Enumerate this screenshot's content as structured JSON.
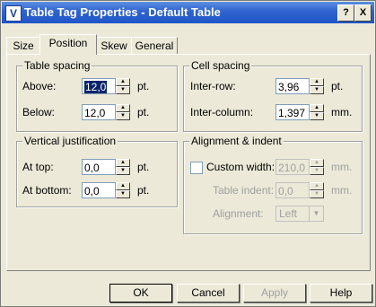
{
  "window": {
    "title": "Table Tag Properties - Default Table",
    "app_icon_letter": "V",
    "help_glyph": "?",
    "close_glyph": "X"
  },
  "tabs": [
    {
      "label": "Size",
      "active": false
    },
    {
      "label": "Position",
      "active": true
    },
    {
      "label": "Skew",
      "active": false
    },
    {
      "label": "General",
      "active": false
    }
  ],
  "table_spacing": {
    "title": "Table spacing",
    "above": {
      "label": "Above:",
      "value": "12,0",
      "unit": "pt."
    },
    "below": {
      "label": "Below:",
      "value": "12,0",
      "unit": "pt."
    }
  },
  "cell_spacing": {
    "title": "Cell spacing",
    "inter_row": {
      "label": "Inter-row:",
      "value": "3,96",
      "unit": "pt."
    },
    "inter_column": {
      "label": "Inter-column:",
      "value": "1,397",
      "unit": "mm."
    }
  },
  "vertical_justification": {
    "title": "Vertical justification",
    "at_top": {
      "label": "At top:",
      "value": "0,0",
      "unit": "pt."
    },
    "at_bottom": {
      "label": "At bottom:",
      "value": "0,0",
      "unit": "pt."
    }
  },
  "alignment_indent": {
    "title": "Alignment & indent",
    "custom_width": {
      "label": "Custom width:",
      "checked": false,
      "value": "210,0",
      "unit": "mm."
    },
    "table_indent": {
      "label": "Table indent:",
      "value": "0,0",
      "unit": "mm."
    },
    "alignment": {
      "label": "Alignment:",
      "value": "Left"
    }
  },
  "buttons": {
    "ok": "OK",
    "cancel": "Cancel",
    "apply": "Apply",
    "help": "Help"
  },
  "colors": {
    "titlebar": "#2f63cf",
    "dialog_bg": "#ece9d8",
    "selection": "#0a246a"
  }
}
